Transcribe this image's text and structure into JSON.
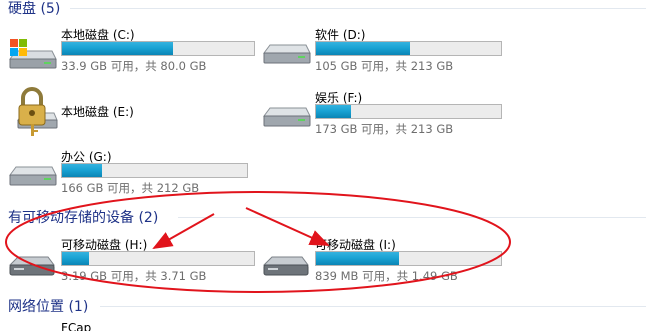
{
  "sections": {
    "hard_disks": "硬盘 (5)",
    "removable": "有可移动存储的设备 (2)",
    "network": "网络位置 (1)"
  },
  "drives": {
    "c": {
      "name": "本地磁盘 (C:)",
      "free_text": "33.9 GB 可用，共 80.0 GB",
      "used_fraction": 0.576,
      "icon": "windows-drive-icon"
    },
    "d": {
      "name": "软件 (D:)",
      "free_text": "105 GB 可用，共 213 GB",
      "used_fraction": 0.507,
      "icon": "hard-drive-icon"
    },
    "e": {
      "name": "本地磁盘 (E:)",
      "icon": "locked-drive-icon"
    },
    "f": {
      "name": "娱乐 (F:)",
      "free_text": "173 GB 可用，共 213 GB",
      "used_fraction": 0.188,
      "icon": "hard-drive-icon"
    },
    "g": {
      "name": "办公 (G:)",
      "free_text": "166 GB 可用，共 212 GB",
      "used_fraction": 0.217,
      "icon": "hard-drive-icon"
    },
    "h": {
      "name": "可移动磁盘 (H:)",
      "free_text": "3.19 GB 可用，共 3.71 GB",
      "used_fraction": 0.14,
      "icon": "usb-drive-icon"
    },
    "i": {
      "name": "可移动磁盘 (I:)",
      "free_text": "839 MB 可用，共 1.49 GB",
      "used_fraction": 0.45,
      "icon": "usb-drive-icon"
    }
  },
  "network_item": "FCap",
  "colors": {
    "section_title": "#1e3287",
    "bar_fill": "#1aa3d4",
    "annotation": "#e1141c"
  }
}
